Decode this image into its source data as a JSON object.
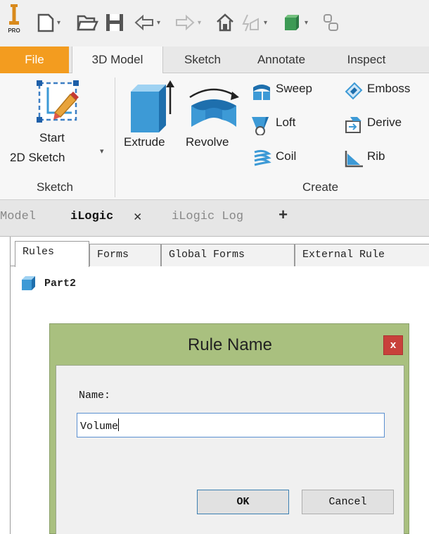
{
  "app": {
    "product_badge": "PRO"
  },
  "ribbon_tabs": {
    "file": "File",
    "model3d": "3D Model",
    "sketch": "Sketch",
    "annotate": "Annotate",
    "inspect": "Inspect"
  },
  "ribbon": {
    "start_sketch_line1": "Start",
    "start_sketch_line2": "2D Sketch",
    "sketch_panel": "Sketch",
    "create_panel": "Create",
    "extrude": "Extrude",
    "revolve": "Revolve",
    "sweep": "Sweep",
    "loft": "Loft",
    "coil": "Coil",
    "emboss": "Emboss",
    "derive": "Derive",
    "rib": "Rib"
  },
  "browser_tabs": {
    "model": "Model",
    "ilogic": "iLogic",
    "ilogic_close": "✕",
    "ilogic_log": "iLogic Log",
    "add": "+"
  },
  "ilogic_panel": {
    "tabs": [
      "Rules",
      "Forms",
      "Global Forms",
      "External Rule"
    ],
    "tree_item": "Part2"
  },
  "dialog": {
    "title": "Rule Name",
    "close_label": "x",
    "name_label": "Name:",
    "name_value": "Volume",
    "ok_label": "OK",
    "cancel_label": "Cancel"
  },
  "colors": {
    "file_tab": "#f39c1f",
    "dialog_frame": "#a9c07f",
    "close_button": "#c8413b",
    "icon_blue": "#3d9ad6"
  }
}
